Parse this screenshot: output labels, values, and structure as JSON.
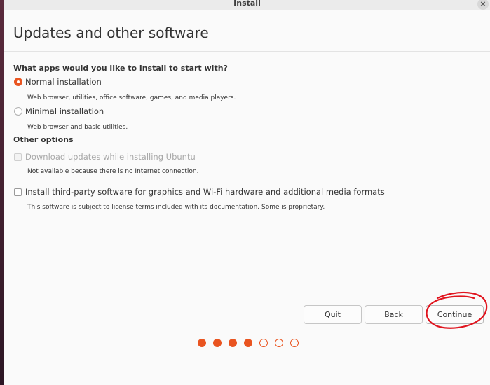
{
  "window": {
    "title": "Install",
    "close_symbol": "×"
  },
  "page": {
    "title": "Updates and other software"
  },
  "apps": {
    "question": "What apps would you like to install to start with?",
    "options": [
      {
        "label": "Normal installation",
        "description": "Web browser, utilities, office software, games, and media players.",
        "selected": true
      },
      {
        "label": "Minimal installation",
        "description": "Web browser and basic utilities.",
        "selected": false
      }
    ]
  },
  "other": {
    "heading": "Other options",
    "items": [
      {
        "label": "Download updates while installing Ubuntu",
        "description": "Not available because there is no Internet connection.",
        "enabled": false,
        "checked": false
      },
      {
        "label": "Install third-party software for graphics and Wi-Fi hardware and additional media formats",
        "description": "This software is subject to license terms included with its documentation. Some is proprietary.",
        "enabled": true,
        "checked": false
      }
    ]
  },
  "buttons": {
    "quit": "Quit",
    "back": "Back",
    "continue": "Continue"
  },
  "progress": {
    "completed_steps": 4,
    "total_steps": 7
  },
  "colors": {
    "accent": "#e95420",
    "annotation": "#e0141e"
  }
}
